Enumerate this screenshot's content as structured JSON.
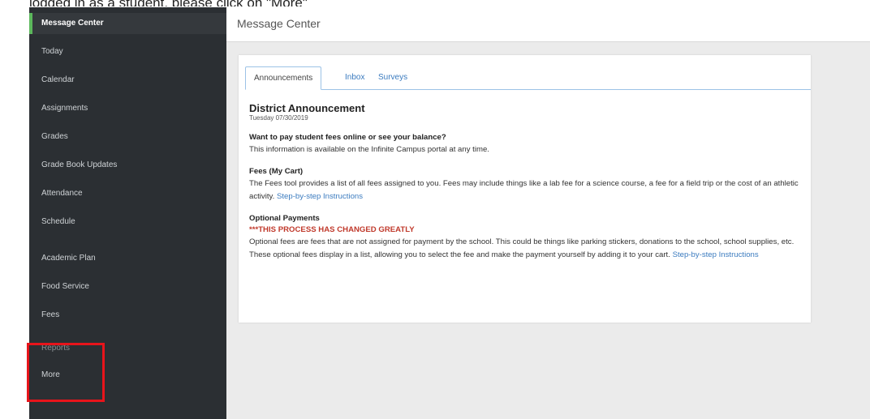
{
  "top_text": "logged in as a student, please click on \"More\"",
  "sidebar": {
    "items": [
      {
        "label": "Message Center"
      },
      {
        "label": "Today"
      },
      {
        "label": "Calendar"
      },
      {
        "label": "Assignments"
      },
      {
        "label": "Grades"
      },
      {
        "label": "Grade Book Updates"
      },
      {
        "label": "Attendance"
      },
      {
        "label": "Schedule"
      },
      {
        "label": "Academic Plan"
      },
      {
        "label": "Food Service"
      },
      {
        "label": "Fees"
      },
      {
        "label": "Reports"
      },
      {
        "label": "More"
      }
    ],
    "highlight_color": "#e8141b",
    "accent_color": "#5cb85c"
  },
  "header": {
    "title": "Message Center"
  },
  "tabs": [
    {
      "label": "Announcements"
    },
    {
      "label": "Inbox"
    },
    {
      "label": "Surveys"
    }
  ],
  "announcement": {
    "title": "District Announcement",
    "date": "Tuesday 07/30/2019",
    "s1": {
      "heading": "Want to pay student fees online or see your balance?",
      "text": "This information is available on the Infinite Campus portal at any time."
    },
    "s2": {
      "heading": "Fees (My Cart)",
      "text": "The Fees tool provides a list of all fees assigned to you. Fees may include things like a lab fee for a science course, a fee for a field trip or the cost of an athletic activity.",
      "link": "Step-by-step Instructions"
    },
    "s3": {
      "heading": "Optional Payments",
      "warning": "***THIS PROCESS HAS CHANGED GREATLY",
      "text": "Optional fees are fees that are not assigned for payment by the school. This could be things like parking stickers, donations to the school, school supplies, etc. These optional fees display in a list, allowing you to select the fee and make the payment yourself by adding it to your cart.",
      "link": "Step-by-step Instructions"
    }
  }
}
